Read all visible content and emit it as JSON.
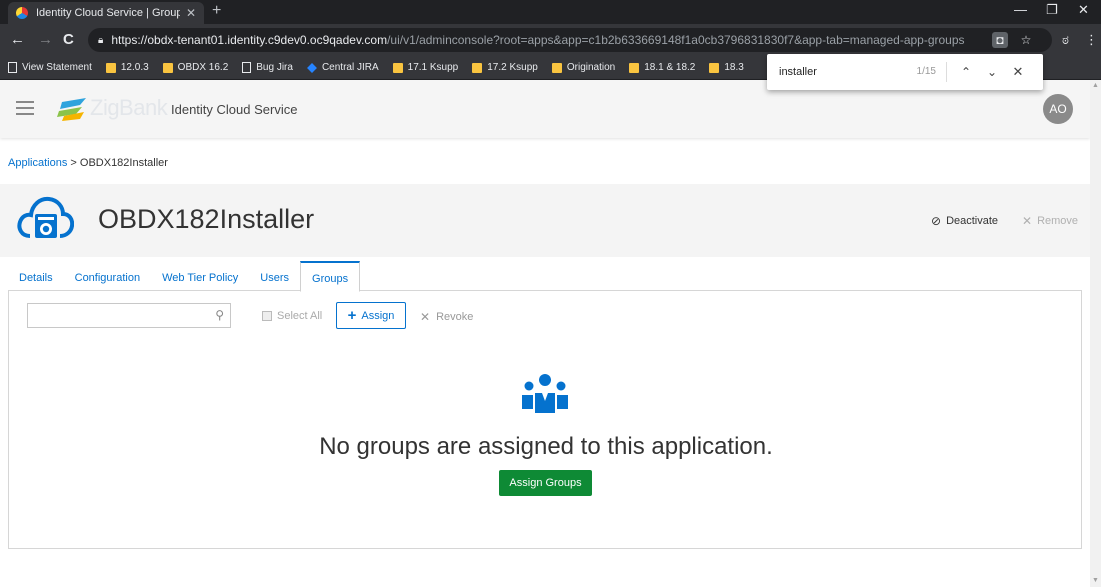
{
  "browser": {
    "tab_title": "Identity Cloud Service | Groups",
    "url_host": "https://obdx-tenant01.identity.c9dev0.oc9qadev.com",
    "url_path": "/ui/v1/adminconsole?root=apps&app=c1b2b633669148f1a0cb3796831830f7&app-tab=managed-app-groups",
    "bookmarks": [
      {
        "label": "View Statement",
        "icon": "page-icon"
      },
      {
        "label": "12.0.3",
        "icon": "folder-icon"
      },
      {
        "label": "OBDX 16.2",
        "icon": "folder-icon"
      },
      {
        "label": "Bug Jira",
        "icon": "page-icon"
      },
      {
        "label": "Central JIRA",
        "icon": "jira-icon"
      },
      {
        "label": "17.1 Ksupp",
        "icon": "folder-icon"
      },
      {
        "label": "17.2 Ksupp",
        "icon": "folder-icon"
      },
      {
        "label": "Origination",
        "icon": "folder-icon"
      },
      {
        "label": "18.1 & 18.2",
        "icon": "folder-icon"
      },
      {
        "label": "18.3",
        "icon": "folder-icon"
      }
    ],
    "find": {
      "query": "installer",
      "count": "1/15"
    }
  },
  "header": {
    "brand": "ZigBank",
    "service": "Identity Cloud Service",
    "avatar": "AO"
  },
  "breadcrumb": {
    "link": "Applications",
    "separator": ">",
    "current": "OBDX182Installer"
  },
  "app": {
    "name": "OBDX182Installer",
    "deactivate": "Deactivate",
    "remove": "Remove"
  },
  "tabs": [
    {
      "label": "Details",
      "active": false
    },
    {
      "label": "Configuration",
      "active": false
    },
    {
      "label": "Web Tier Policy",
      "active": false
    },
    {
      "label": "Users",
      "active": false
    },
    {
      "label": "Groups",
      "active": true
    }
  ],
  "toolbar": {
    "search_placeholder": "",
    "select_all": "Select All",
    "assign": "Assign",
    "revoke": "Revoke"
  },
  "empty": {
    "message": "No groups are assigned to this application.",
    "button": "Assign Groups"
  },
  "colors": {
    "link": "#0572ce",
    "primary_button": "#0e8a35"
  }
}
